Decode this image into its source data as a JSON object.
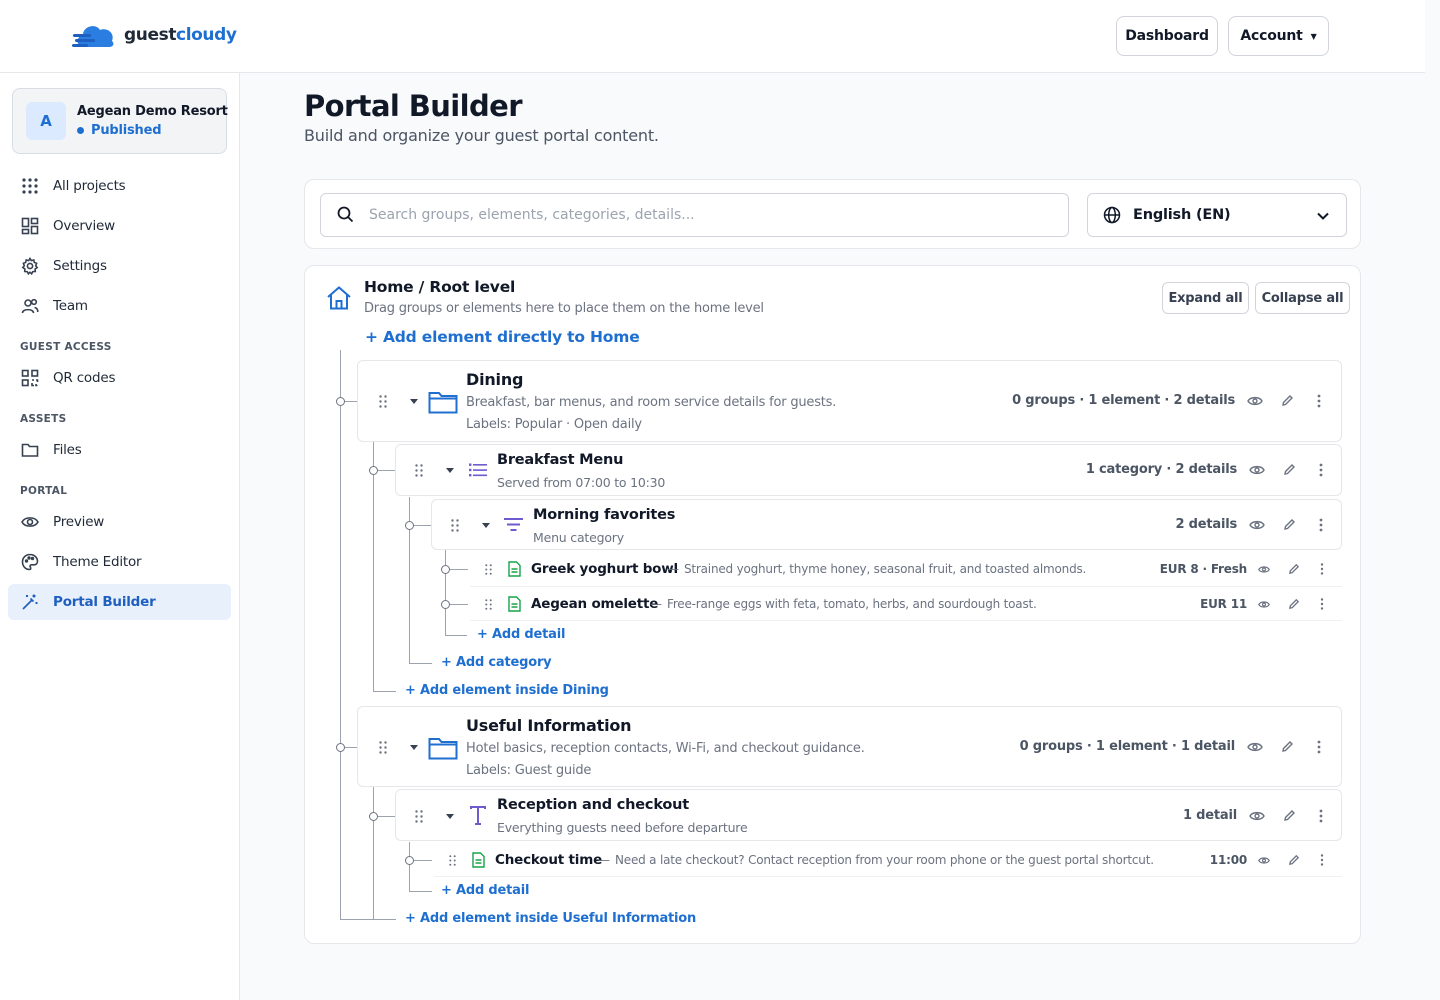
{
  "app": {
    "logo_text_1": "guest",
    "logo_text_2": "cloudy"
  },
  "header": {
    "dashboard_label": "Dashboard",
    "account_label": "Account"
  },
  "project": {
    "avatar_letter": "A",
    "name": "Aegean Demo Resort",
    "status": "Published"
  },
  "sidebar": {
    "items": [
      {
        "label": "All projects",
        "icon": "grid-dots-icon"
      },
      {
        "label": "Overview",
        "icon": "dashboard-icon"
      },
      {
        "label": "Settings",
        "icon": "gear-icon"
      },
      {
        "label": "Team",
        "icon": "users-icon"
      }
    ],
    "section_guest_access": "GUEST ACCESS",
    "qr_codes": "QR codes",
    "section_assets": "ASSETS",
    "files": "Files",
    "section_portal": "PORTAL",
    "preview": "Preview",
    "theme_editor": "Theme Editor",
    "portal_builder": "Portal Builder"
  },
  "page": {
    "title": "Portal Builder",
    "subtitle": "Build and organize your guest portal content."
  },
  "search": {
    "placeholder": "Search groups, elements, categories, details...",
    "language": "English (EN)"
  },
  "tree": {
    "home_title": "Home / Root level",
    "home_sub": "Drag groups or elements here to place them on the home level",
    "expand_all": "Expand all",
    "collapse_all": "Collapse all",
    "add_home": "+ Add element directly to Home",
    "dining": {
      "title": "Dining",
      "desc": "Breakfast, bar menus, and room service details for guests.",
      "labels": "Labels: Popular · Open daily",
      "meta": "0 groups · 1 element · 2 details"
    },
    "breakfast": {
      "title": "Breakfast Menu",
      "desc": "Served from 07:00 to 10:30",
      "meta": "1 category · 2 details"
    },
    "morning": {
      "title": "Morning favorites",
      "desc": "Menu category",
      "meta": "2 details"
    },
    "details_dining": [
      {
        "title": "Greek yoghurt bowl",
        "sep": "—",
        "desc": "Strained yoghurt, thyme honey, seasonal fruit, and toasted almonds.",
        "meta": "EUR 8 · Fresh"
      },
      {
        "title": "Aegean omelette",
        "sep": "—",
        "desc": "Free-range eggs with feta, tomato, herbs, and sourdough toast.",
        "meta": "EUR 11"
      }
    ],
    "add_detail": "+ Add detail",
    "add_category": "+ Add category",
    "add_inside_dining": "+ Add element inside Dining",
    "useful": {
      "title": "Useful Information",
      "desc": "Hotel basics, reception contacts, Wi-Fi, and checkout guidance.",
      "labels": "Labels: Guest guide",
      "meta": "0 groups · 1 element · 1 detail"
    },
    "reception": {
      "title": "Reception and checkout",
      "desc": "Everything guests need before departure",
      "meta": "1 detail"
    },
    "checkout": {
      "title": "Checkout time",
      "sep": "—",
      "desc": "Need a late checkout? Contact reception from your room phone or the guest portal shortcut.",
      "meta": "11:00"
    },
    "add_detail_2": "+ Add detail",
    "add_inside_useful": "+ Add element inside Useful Information"
  },
  "colors": {
    "accent": "#1f6fd1",
    "active_bg": "#e8f0fb",
    "detail_icon": "#16a34a",
    "element_icon": "#6d5bd0"
  }
}
